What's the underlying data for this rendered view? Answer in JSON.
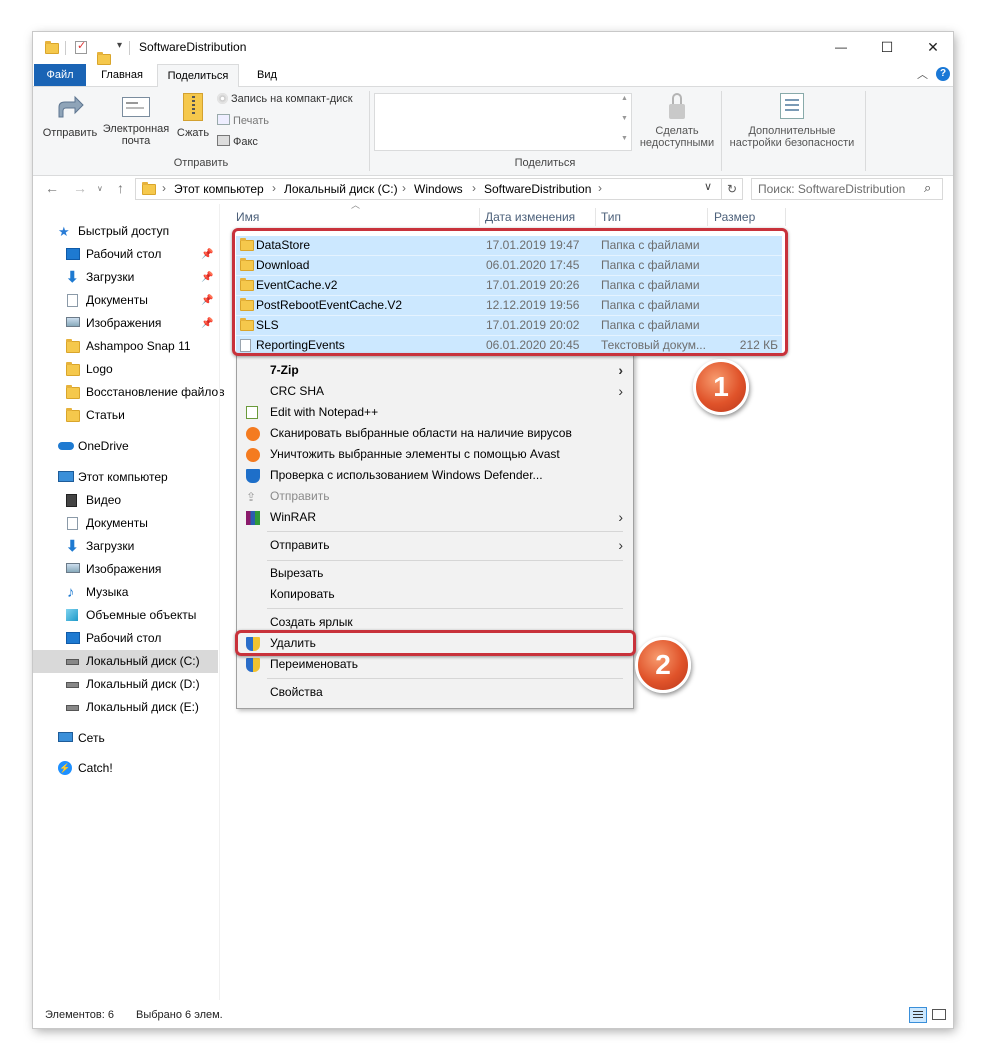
{
  "window": {
    "title": "SoftwareDistribution",
    "minimize": "—",
    "maximize": "☐",
    "close": "✕"
  },
  "ribbon": {
    "tabs": [
      "Файл",
      "Главная",
      "Поделиться",
      "Вид"
    ],
    "active_tab": "Поделиться",
    "send_group": {
      "send_label": "Отправить",
      "email_label": "Электронная почта",
      "email_line1": "Электронная",
      "email_line2": "почта",
      "zip_label": "Сжать",
      "burn_label": "Запись на компакт-диск",
      "print_label": "Печать",
      "fax_label": "Факс",
      "group_label": "Отправить"
    },
    "share_group": {
      "group_label": "Поделиться",
      "unshare_line1": "Сделать",
      "unshare_line2": "недоступными",
      "security_line1": "Дополнительные",
      "security_line2": "настройки безопасности"
    }
  },
  "addressbar": {
    "crumbs": [
      "Этот компьютер",
      "Локальный диск (C:)",
      "Windows",
      "SoftwareDistribution"
    ],
    "search_placeholder": "Поиск: SoftwareDistribution"
  },
  "sidebar": {
    "quick_access": "Быстрый доступ",
    "quick_items": [
      {
        "label": "Рабочий стол",
        "pinned": true
      },
      {
        "label": "Загрузки",
        "pinned": true
      },
      {
        "label": "Документы",
        "pinned": true
      },
      {
        "label": "Изображения",
        "pinned": true
      },
      {
        "label": "Ashampoo Snap 11",
        "pinned": false
      },
      {
        "label": "Logo",
        "pinned": false
      },
      {
        "label": "Восстановление файлов",
        "pinned": false
      },
      {
        "label": "Статьи",
        "pinned": false
      }
    ],
    "onedrive": "OneDrive",
    "this_pc": "Этот компьютер",
    "pc_items": [
      "Видео",
      "Документы",
      "Загрузки",
      "Изображения",
      "Музыка",
      "Объемные объекты",
      "Рабочий стол",
      "Локальный диск (C:)",
      "Локальный диск (D:)",
      "Локальный диск (E:)"
    ],
    "network": "Сеть",
    "catch": "Catch!"
  },
  "filelist": {
    "columns": [
      "Имя",
      "Дата изменения",
      "Тип",
      "Размер"
    ],
    "rows": [
      {
        "name": "DataStore",
        "date": "17.01.2019 19:47",
        "type": "Папка с файлами",
        "size": ""
      },
      {
        "name": "Download",
        "date": "06.01.2020 17:45",
        "type": "Папка с файлами",
        "size": ""
      },
      {
        "name": "EventCache.v2",
        "date": "17.01.2019 20:26",
        "type": "Папка с файлами",
        "size": ""
      },
      {
        "name": "PostRebootEventCache.V2",
        "date": "12.12.2019 19:56",
        "type": "Папка с файлами",
        "size": ""
      },
      {
        "name": "SLS",
        "date": "17.01.2019 20:02",
        "type": "Папка с файлами",
        "size": ""
      },
      {
        "name": "ReportingEvents",
        "date": "06.01.2020 20:45",
        "type": "Текстовый докум...",
        "size": "212 КБ"
      }
    ]
  },
  "context_menu": {
    "items": [
      {
        "label": "7-Zip",
        "submenu": true,
        "bold": true
      },
      {
        "label": "CRC SHA",
        "submenu": true
      },
      {
        "label": "Edit with Notepad++"
      },
      {
        "label": "Сканировать выбранные области на наличие вирусов"
      },
      {
        "label": "Уничтожить выбранные элементы с помощью Avast"
      },
      {
        "label": "Проверка с использованием Windows Defender..."
      },
      {
        "label": "Отправить",
        "disabled": true
      },
      {
        "label": "WinRAR",
        "submenu": true
      },
      {
        "label": "Отправить",
        "submenu": true
      },
      {
        "label": "Вырезать"
      },
      {
        "label": "Копировать"
      },
      {
        "label": "Создать ярлык"
      },
      {
        "label": "Удалить"
      },
      {
        "label": "Переименовать"
      },
      {
        "label": "Свойства"
      }
    ]
  },
  "annotations": {
    "badge1": "1",
    "badge2": "2",
    "color": "#c8323b"
  },
  "status": {
    "count": "Элементов: 6",
    "selected": "Выбрано 6 элем."
  }
}
